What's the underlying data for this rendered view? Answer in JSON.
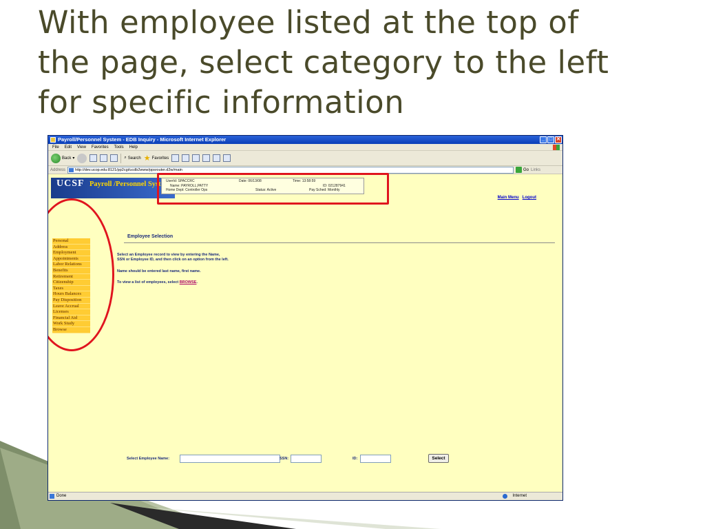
{
  "slide": {
    "title_line1": "With employee listed at the top of",
    "title_line2": "the page, select category to the left",
    "title_line3": "for specific information"
  },
  "browser": {
    "window_title": "Payroll/Personnel System - EDB Inquiry - Microsoft Internet Explorer",
    "menu": [
      "File",
      "Edit",
      "View",
      "Favorites",
      "Tools",
      "Help"
    ],
    "toolbar": {
      "back": "Back",
      "search": "Search",
      "favorites": "Favorites"
    },
    "address_label": "Address",
    "url": "http://dev.ucop.edu:8121/pp2cgi/ucdb2www/ppsrouter.d2w/main",
    "go_label": "Go",
    "links_label": "Links",
    "status_text": "Done",
    "zone_text": "Internet"
  },
  "page": {
    "logo": {
      "ucsf": "UCSF",
      "system": "Payroll /Personnel System"
    },
    "info": {
      "userid": "UserId: SPACCRC",
      "date": "Date: 06/13/08",
      "time": "Time: 13:58:59",
      "name": "Name: PAYROLL,PATTY",
      "id": "ID: 021287941",
      "home_dept": "Home Dept: Controller Ops",
      "status": "Status: Active",
      "pay_sched": "Pay Sched: Monthly"
    },
    "top_links": {
      "main_menu": "Main Menu",
      "logout": "Logout"
    },
    "sidebar": [
      "Personal",
      "Address",
      "Employment",
      "Appointments",
      "Labor Relations",
      "Benefits",
      "Retirement",
      "Citizenship",
      "Taxes",
      "Hours Balances",
      "Pay Disposition",
      "Leave Accrual",
      "Licenses",
      "Financial Aid",
      "Work Study",
      "Browse"
    ],
    "section_title": "Employee Selection",
    "instr1": "Select an Employee record to view by entering the Name,",
    "instr2": "SSN or Employee ID, and then click on an option from the left.",
    "instr3": "Name should be entered last name, first name.",
    "instr4_prefix": "To view a list of employees, select ",
    "instr4_link": "BROWSE",
    "instr4_suffix": ".",
    "form": {
      "name_label": "Select Employee Name:",
      "ssn_label": "SSN:",
      "id_label": "ID:",
      "select_button": "Select"
    }
  },
  "colors": {
    "page_bg": "#ffffc0",
    "sidebar_bg": "#ffcc33",
    "highlight_red": "#e0141e",
    "title_text": "#4a4a2a"
  }
}
